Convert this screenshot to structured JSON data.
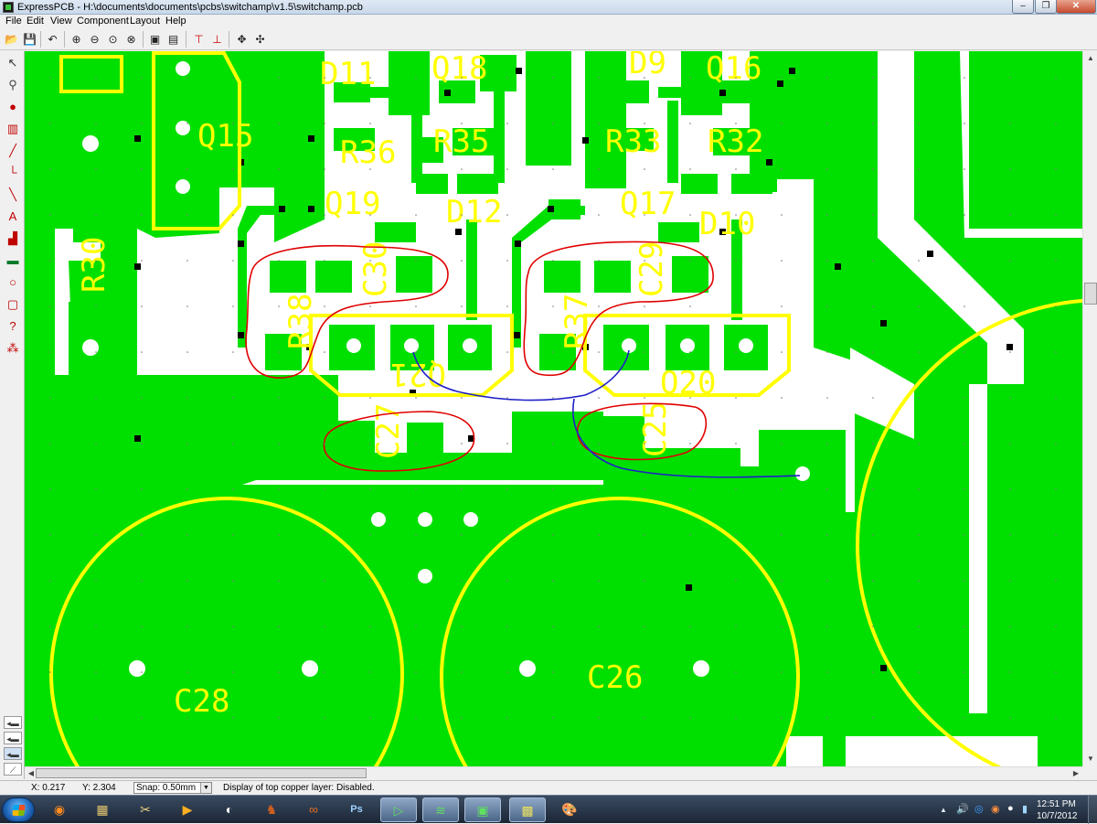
{
  "window": {
    "title": "ExpressPCB - H:\\documents\\documents\\pcbs\\switchamp\\v1.5\\switchamp.pcb",
    "min_icon": "minimize-icon",
    "max_icon": "maximize-icon",
    "close_icon": "close-icon",
    "min_glyph": "–",
    "max_glyph": "❐",
    "close_glyph": "✕"
  },
  "menu": {
    "items": [
      {
        "label": "File"
      },
      {
        "label": "Edit"
      },
      {
        "label": "View"
      },
      {
        "label": "Component"
      },
      {
        "label": "Layout"
      },
      {
        "label": "Help"
      }
    ]
  },
  "toolbar": {
    "buttons": [
      {
        "name": "open-file-button",
        "icon": "folder-open-icon",
        "glyph": "📂"
      },
      {
        "name": "save-file-button",
        "icon": "floppy-icon",
        "glyph": "💾"
      },
      {
        "name": "undo-button",
        "icon": "undo-icon",
        "glyph": "↶"
      },
      {
        "name": "zoom-in-button",
        "icon": "zoom-in-icon",
        "glyph": "⊕"
      },
      {
        "name": "zoom-out-button",
        "icon": "zoom-out-icon",
        "glyph": "⊖"
      },
      {
        "name": "zoom-window-button",
        "icon": "zoom-window-icon",
        "glyph": "⊙"
      },
      {
        "name": "zoom-fit-button",
        "icon": "zoom-fit-icon",
        "glyph": "⊗"
      },
      {
        "name": "component-props-button",
        "icon": "component-icon",
        "glyph": "▣"
      },
      {
        "name": "component-edit-button",
        "icon": "component-edit-icon",
        "glyph": "▤"
      },
      {
        "name": "mirror-top-button",
        "icon": "mirror-top-icon",
        "glyph": "⊤"
      },
      {
        "name": "mirror-bottom-button",
        "icon": "mirror-bottom-icon",
        "glyph": "⊥"
      },
      {
        "name": "move-button",
        "icon": "move-icon",
        "glyph": "✥"
      },
      {
        "name": "move-all-button",
        "icon": "move-all-icon",
        "glyph": "✣"
      }
    ]
  },
  "tools": {
    "items": [
      {
        "name": "select-tool",
        "icon": "arrow-pointer-icon",
        "glyph": "↖"
      },
      {
        "name": "component-select-tool",
        "icon": "component-select-icon",
        "glyph": "⚲"
      },
      {
        "name": "pad-tool",
        "icon": "pad-icon",
        "glyph": "●"
      },
      {
        "name": "ic-tool",
        "icon": "ic-icon",
        "glyph": "▥"
      },
      {
        "name": "trace-tool",
        "icon": "trace-icon",
        "glyph": "╱"
      },
      {
        "name": "trace-corner-tool",
        "icon": "trace-corner-icon",
        "glyph": "└"
      },
      {
        "name": "diagonal-trace-tool",
        "icon": "diagonal-trace-icon",
        "glyph": "╲"
      },
      {
        "name": "text-tool",
        "icon": "text-icon",
        "glyph": "A"
      },
      {
        "name": "fill-tool",
        "icon": "fill-icon",
        "glyph": "▟"
      },
      {
        "name": "plane-tool",
        "icon": "plane-icon",
        "glyph": "▬"
      },
      {
        "name": "hole-tool",
        "icon": "hole-icon",
        "glyph": "○"
      },
      {
        "name": "rect-tool",
        "icon": "rectangle-icon",
        "glyph": "▢"
      },
      {
        "name": "query-tool",
        "icon": "query-icon",
        "glyph": "?"
      },
      {
        "name": "net-tool",
        "icon": "net-icon",
        "glyph": "⁂"
      }
    ],
    "layers": [
      {
        "name": "layer-top-button",
        "glyph": "◂▬"
      },
      {
        "name": "layer-bottom-button",
        "glyph": "◂▬"
      },
      {
        "name": "layer-both-button",
        "glyph": "◂▬"
      },
      {
        "name": "layer-silk-button",
        "glyph": "⟋"
      }
    ]
  },
  "board": {
    "colors": {
      "copper": "#00e000",
      "silk": "#ffff00",
      "background": "#ffffff",
      "via": "#000000",
      "annotation_red": "#e00000",
      "annotation_blue": "#2020c8"
    },
    "labels": [
      {
        "text": "D11"
      },
      {
        "text": "Q18"
      },
      {
        "text": "D9"
      },
      {
        "text": "Q16"
      },
      {
        "text": "Q15"
      },
      {
        "text": "R36"
      },
      {
        "text": "R35"
      },
      {
        "text": "R33"
      },
      {
        "text": "R32"
      },
      {
        "text": "Q19"
      },
      {
        "text": "D12"
      },
      {
        "text": "Q17"
      },
      {
        "text": "D10"
      },
      {
        "text": "R30"
      },
      {
        "text": "C30"
      },
      {
        "text": "C29"
      },
      {
        "text": "R38"
      },
      {
        "text": "R37"
      },
      {
        "text": "Q21"
      },
      {
        "text": "Q20"
      },
      {
        "text": "C27"
      },
      {
        "text": "C25"
      },
      {
        "text": "C28"
      },
      {
        "text": "C26"
      }
    ]
  },
  "status": {
    "x": "X: 0.217",
    "y": "Y: 2.304",
    "snap": "Snap:  0.50mm",
    "message": "Display of top copper layer:  Disabled."
  },
  "taskbar": {
    "apps": [
      {
        "name": "taskbar-firefox",
        "icon": "firefox-icon",
        "glyph": "◉"
      },
      {
        "name": "taskbar-explorer",
        "icon": "folder-icon",
        "glyph": "▦"
      },
      {
        "name": "taskbar-tools",
        "icon": "tools-icon",
        "glyph": "✂"
      },
      {
        "name": "taskbar-media",
        "icon": "media-play-icon",
        "glyph": "▶"
      },
      {
        "name": "taskbar-live",
        "icon": "live-icon",
        "glyph": "◐"
      },
      {
        "name": "taskbar-spartan",
        "icon": "helmet-icon",
        "glyph": "♞"
      },
      {
        "name": "taskbar-arduino",
        "icon": "infinity-icon",
        "glyph": "∞"
      },
      {
        "name": "taskbar-photoshop",
        "icon": "photoshop-icon",
        "glyph": "Ps"
      },
      {
        "name": "taskbar-schematic",
        "icon": "schematic-icon",
        "glyph": "▷"
      },
      {
        "name": "taskbar-pcb",
        "icon": "pcb-icon",
        "glyph": "≋"
      },
      {
        "name": "taskbar-expresspcb",
        "icon": "expresspcb-icon",
        "glyph": "▣"
      },
      {
        "name": "taskbar-board",
        "icon": "board-icon",
        "glyph": "▩"
      },
      {
        "name": "taskbar-paint",
        "icon": "paint-icon",
        "glyph": "🎨"
      }
    ],
    "tray": [
      {
        "name": "tray-arrow",
        "glyph": "▲"
      },
      {
        "name": "tray-volume",
        "glyph": "🔊"
      },
      {
        "name": "tray-app1",
        "glyph": "◎"
      },
      {
        "name": "tray-app2",
        "glyph": "◉"
      },
      {
        "name": "tray-app3",
        "glyph": "●"
      },
      {
        "name": "tray-network",
        "glyph": "▮"
      }
    ],
    "time": "12:51 PM",
    "date": "10/7/2012"
  }
}
